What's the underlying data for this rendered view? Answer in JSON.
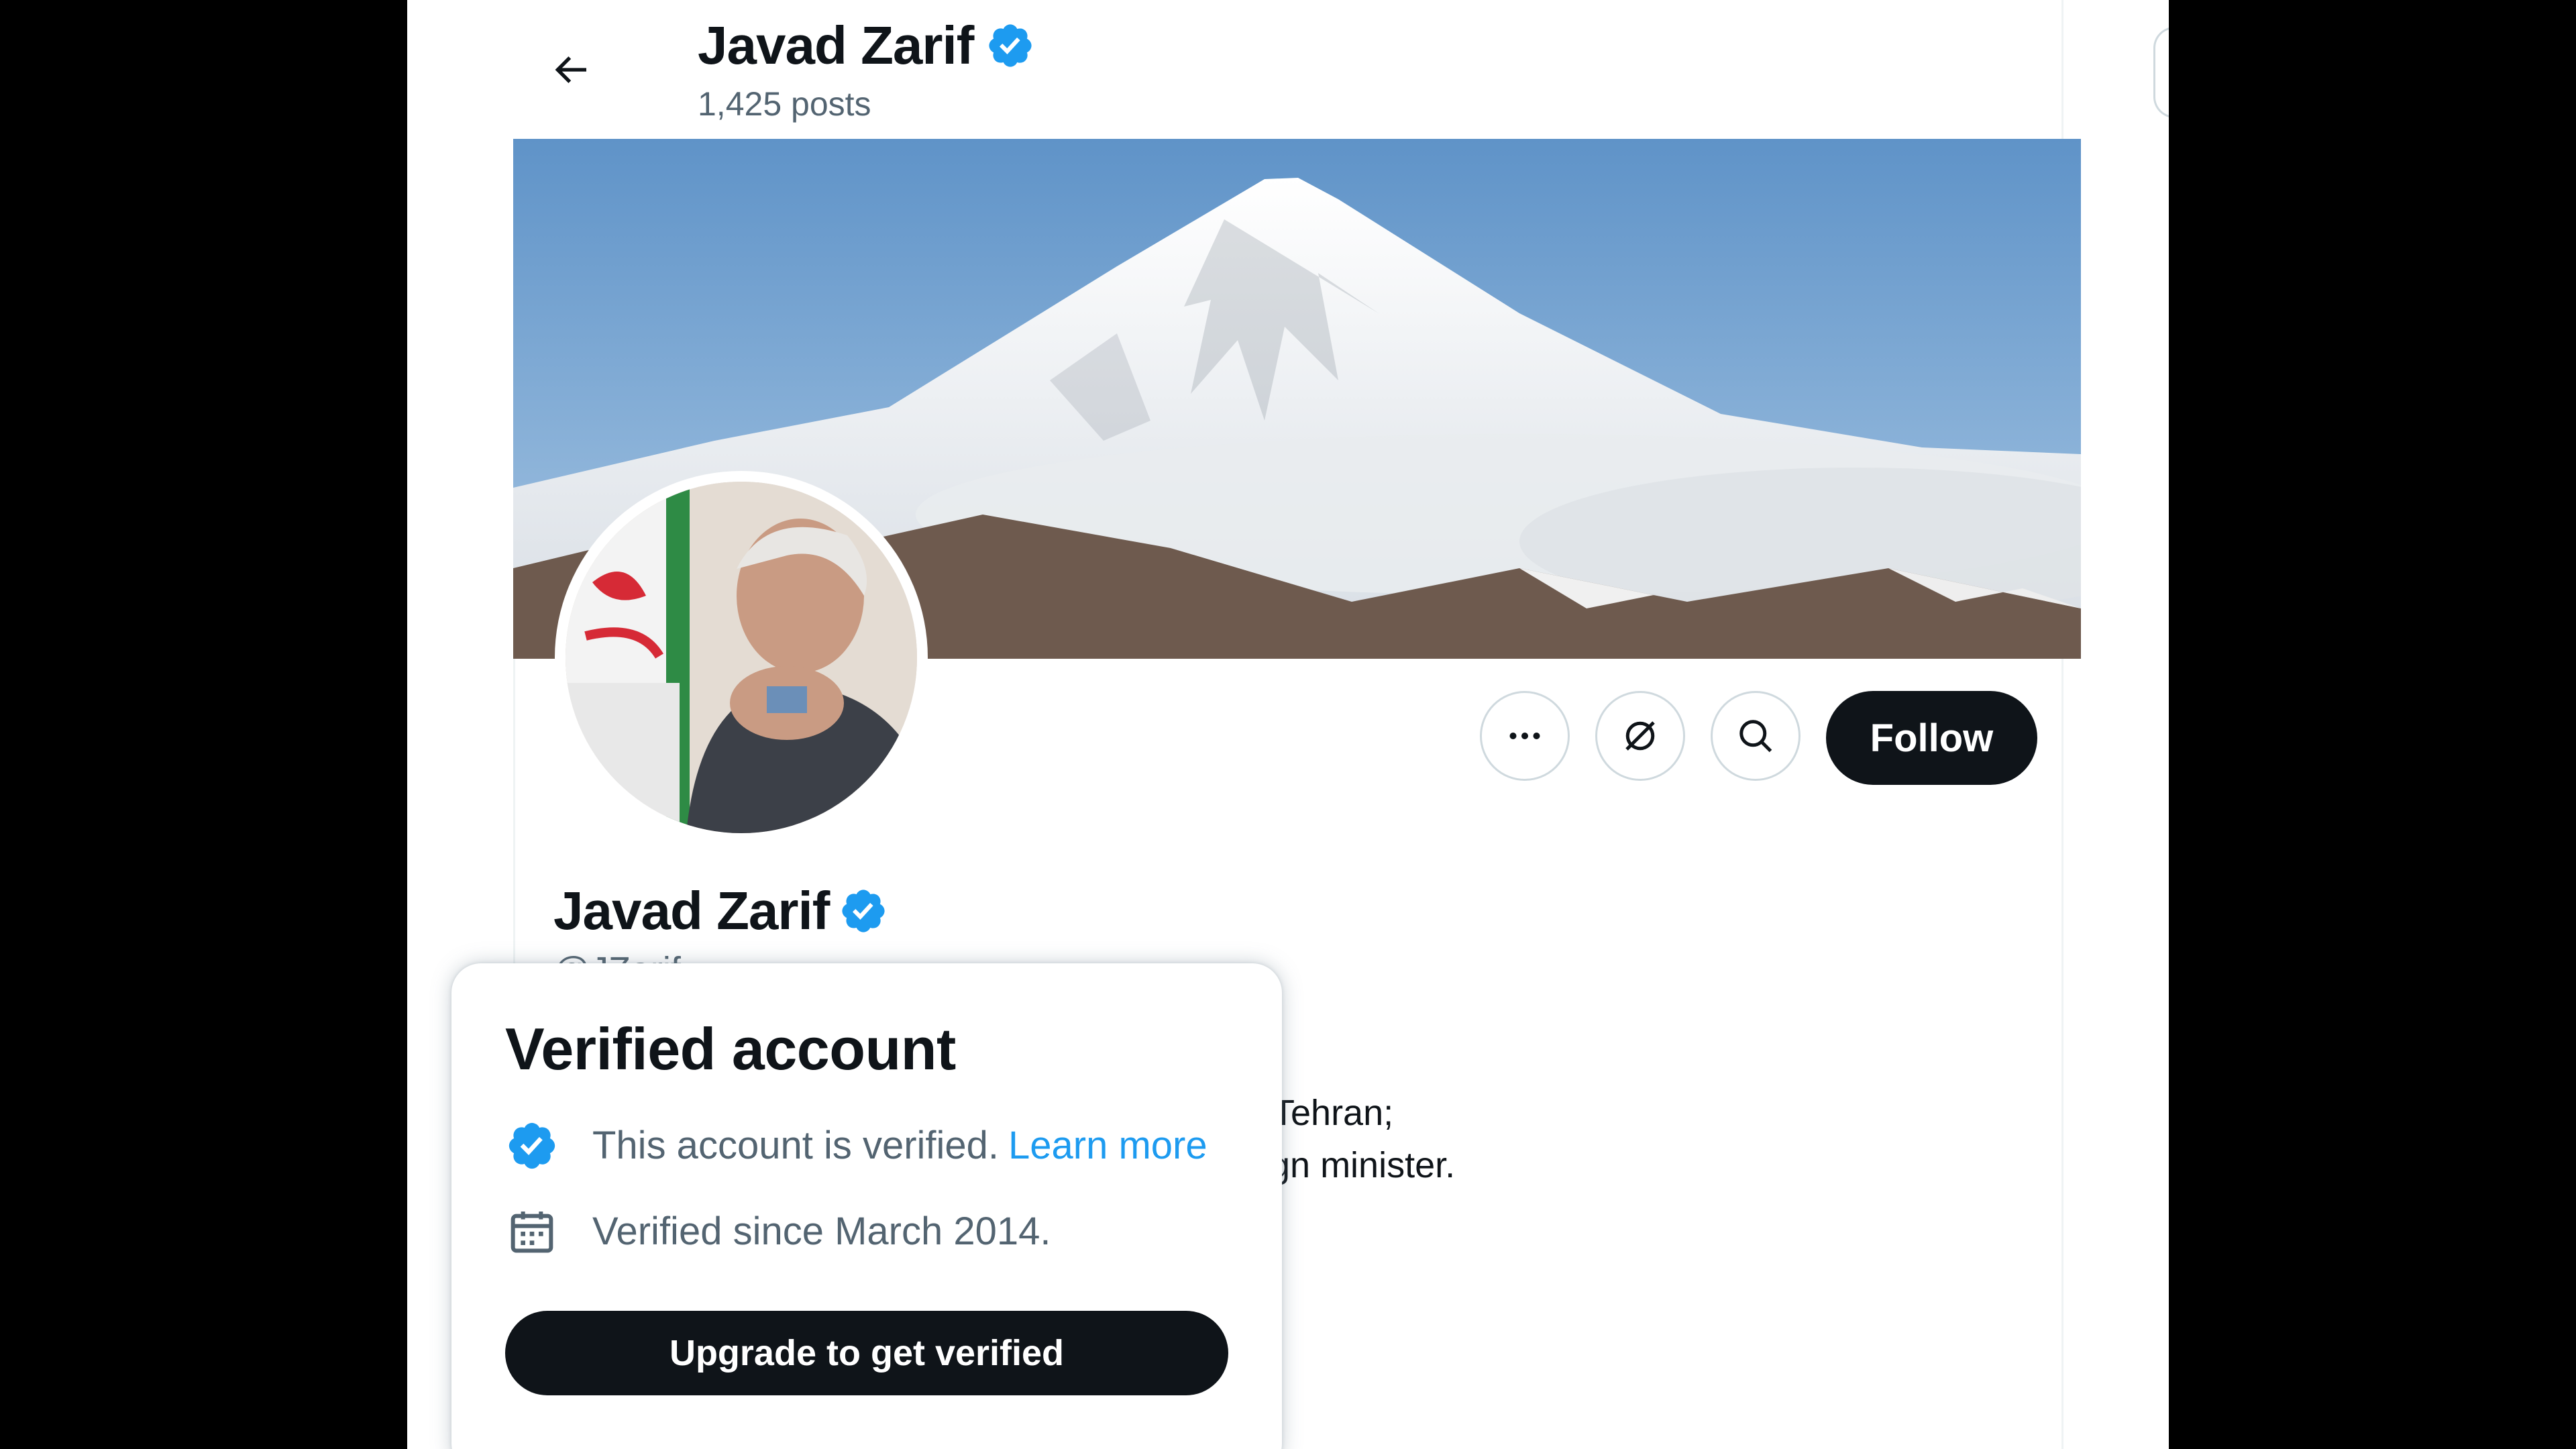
{
  "header": {
    "name": "Javad Zarif",
    "posts_count": "1,425 posts"
  },
  "profile": {
    "name": "Javad Zarif",
    "handle": "@JZarif",
    "bio_line1": "Tehran;",
    "bio_line2": "gn minister."
  },
  "actions": {
    "follow_label": "Follow",
    "more_icon": "more-icon",
    "subscribe_icon": "grok-icon",
    "search_icon": "search-icon"
  },
  "popup": {
    "title": "Verified account",
    "verified_text": "This account is verified.",
    "learn_more": "Learn more",
    "since_text": "Verified since March 2014.",
    "upgrade_label": "Upgrade to get verified"
  },
  "colors": {
    "accent": "#1d9bf0",
    "text": "#0f1419",
    "secondary": "#536471"
  }
}
